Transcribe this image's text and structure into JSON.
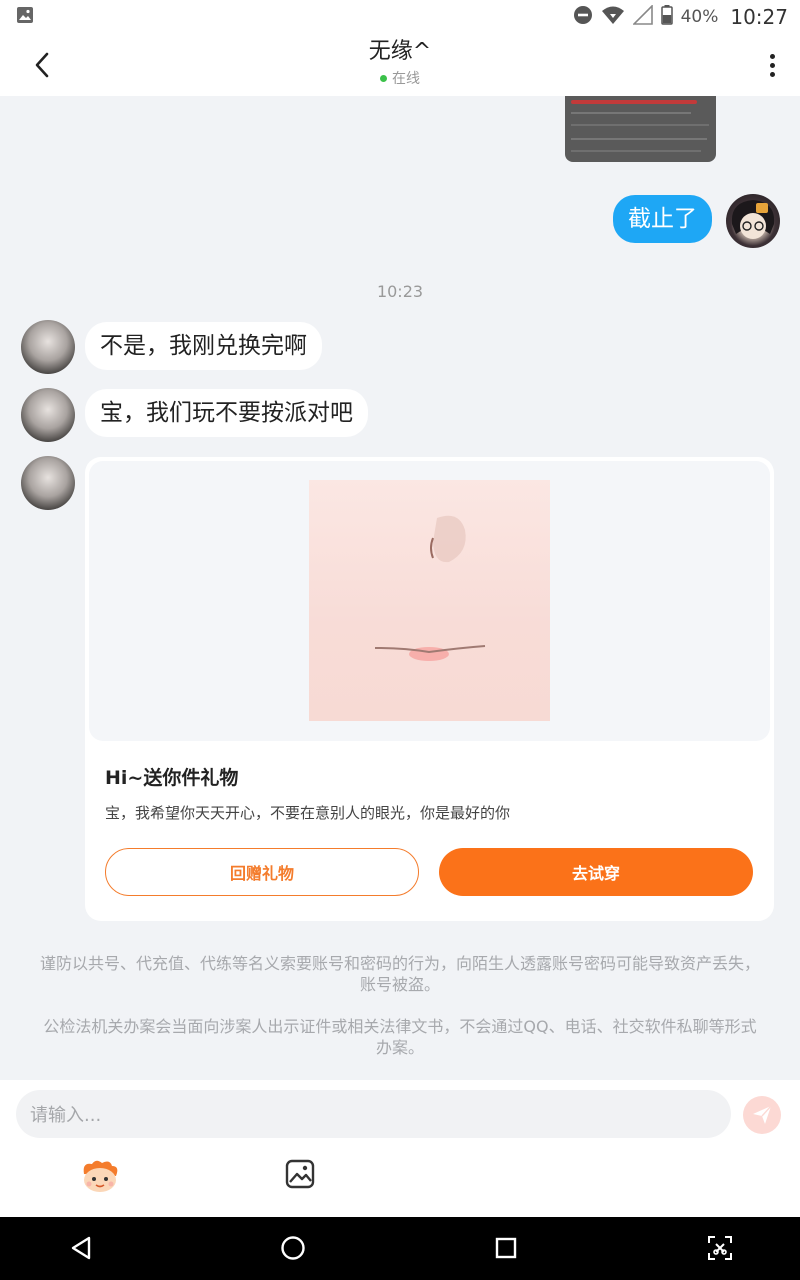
{
  "status_bar": {
    "battery": "40%",
    "time": "10:27",
    "icons": [
      "image-notification-icon",
      "do-not-disturb-icon",
      "wifi-icon",
      "signal-icon",
      "battery-icon"
    ]
  },
  "header": {
    "contact_name": "无缘^",
    "status": "在线",
    "status_color": "#3bc14a"
  },
  "messages": [
    {
      "side": "out",
      "type": "image",
      "label": ""
    },
    {
      "side": "out",
      "type": "text",
      "text": "截止了"
    },
    {
      "type": "time",
      "text": "10:23"
    },
    {
      "side": "in",
      "type": "text",
      "text": "不是，我刚兑换完啊"
    },
    {
      "side": "in",
      "type": "text",
      "text": "宝，我们玩不要按派对吧"
    }
  ],
  "gift_card": {
    "title": "Hi~送你件礼物",
    "description": "宝，我希望你天天开心，不要在意别人的眼光，你是最好的你",
    "return_button": "回赠礼物",
    "try_button": "去试穿",
    "accent_color": "#fb7219"
  },
  "notices": [
    "谨防以共号、代充值、代练等名义索要账号和密码的行为，向陌生人透露账号密码可能导致资产丢失，账号被盗。",
    "公检法机关办案会当面向涉案人出示证件或相关法律文书，不会通过QQ、电话、社交软件私聊等形式办案。"
  ],
  "input": {
    "placeholder": "请输入..."
  },
  "colors": {
    "outgoing_bubble": "#1ea7f5",
    "background": "#f1f3f6"
  }
}
